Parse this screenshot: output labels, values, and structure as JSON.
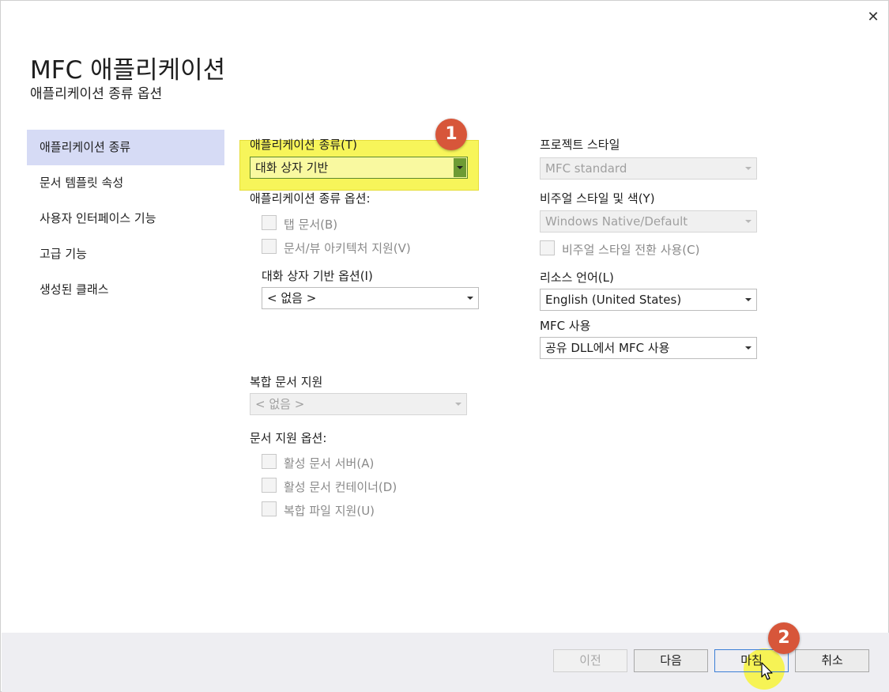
{
  "window": {
    "close_glyph": "✕"
  },
  "header": {
    "title": "MFC 애플리케이션",
    "subtitle": "애플리케이션 종류 옵션"
  },
  "sidebar": {
    "items": [
      {
        "label": "애플리케이션 종류",
        "active": true
      },
      {
        "label": "문서 템플릿 속성",
        "active": false
      },
      {
        "label": "사용자 인터페이스 기능",
        "active": false
      },
      {
        "label": "고급 기능",
        "active": false
      },
      {
        "label": "생성된 클래스",
        "active": false
      }
    ]
  },
  "app_type": {
    "label": "애플리케이션 종류(T)",
    "value": "대화 상자 기반",
    "options_label": "애플리케이션 종류 옵션:",
    "tabbed_docs": "탭 문서(B)",
    "doc_view": "문서/뷰 아키텍처 지원(V)",
    "dialog_options_label": "대화 상자 기반 옵션(I)",
    "dialog_options_value": "< 없음 >"
  },
  "compound": {
    "label": "복합 문서 지원",
    "value": "< 없음 >",
    "doc_options_label": "문서 지원 옵션:",
    "active_server": "활성 문서 서버(A)",
    "active_container": "활성 문서 컨테이너(D)",
    "compound_file": "복합 파일 지원(U)"
  },
  "project_style": {
    "label": "프로젝트 스타일",
    "value": "MFC standard",
    "visual_label": "비주얼 스타일 및 색(Y)",
    "visual_value": "Windows Native/Default",
    "visual_switch": "비주얼 스타일 전환 사용(C)",
    "resource_label": "리소스 언어(L)",
    "resource_value": "English (United States)",
    "mfc_label": "MFC 사용",
    "mfc_value": "공유 DLL에서 MFC 사용"
  },
  "buttons": {
    "prev": "이전",
    "next": "다음",
    "finish": "마침",
    "cancel": "취소"
  },
  "annotations": {
    "badge1": "1",
    "badge2": "2"
  },
  "colors": {
    "badge": "#d7563a",
    "highlight": "#f7f55a",
    "sidebar_active": "#d6dbf5"
  }
}
